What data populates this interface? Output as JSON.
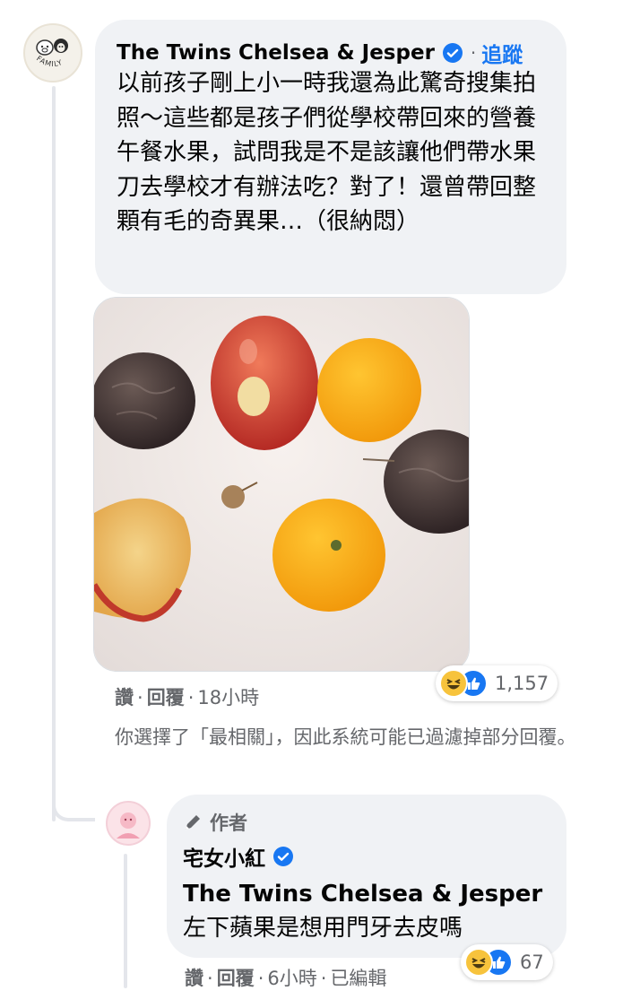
{
  "main_comment": {
    "author": "The Twins Chelsea & Jesper",
    "follow_label": "追蹤",
    "separator": "·",
    "text": "以前孩子剛上小一時我還為此驚奇搜集拍照～這些都是孩子們從學校帶回來的營養午餐水果，試問我是不是該讓他們帶水果刀去學校才有辦法吃？對了！還曾帶回整顆有毛的奇異果…（很納悶）",
    "avatar_label": "FAMILY",
    "actions": {
      "like": "讚",
      "reply": "回覆",
      "time": "18小時"
    },
    "reaction_count": "1,157"
  },
  "filter_note": "你選擇了「最相關」，因此系統可能已過濾掉部分回覆。",
  "reply": {
    "badge": "作者",
    "author": "宅女小紅",
    "mention": "The Twins Chelsea & Jesper",
    "text": "左下蘋果是想用門牙去皮嗎",
    "actions": {
      "like": "讚",
      "reply": "回覆",
      "time": "6小時",
      "edited": "已編輯"
    },
    "reaction_count": "67"
  },
  "colors": {
    "bubble": "#f0f2f5",
    "link": "#1877f2",
    "meta": "#65676b",
    "text": "#050505"
  },
  "icons": [
    "verified-badge-icon",
    "haha-reaction-icon",
    "like-reaction-icon",
    "pencil-icon"
  ]
}
